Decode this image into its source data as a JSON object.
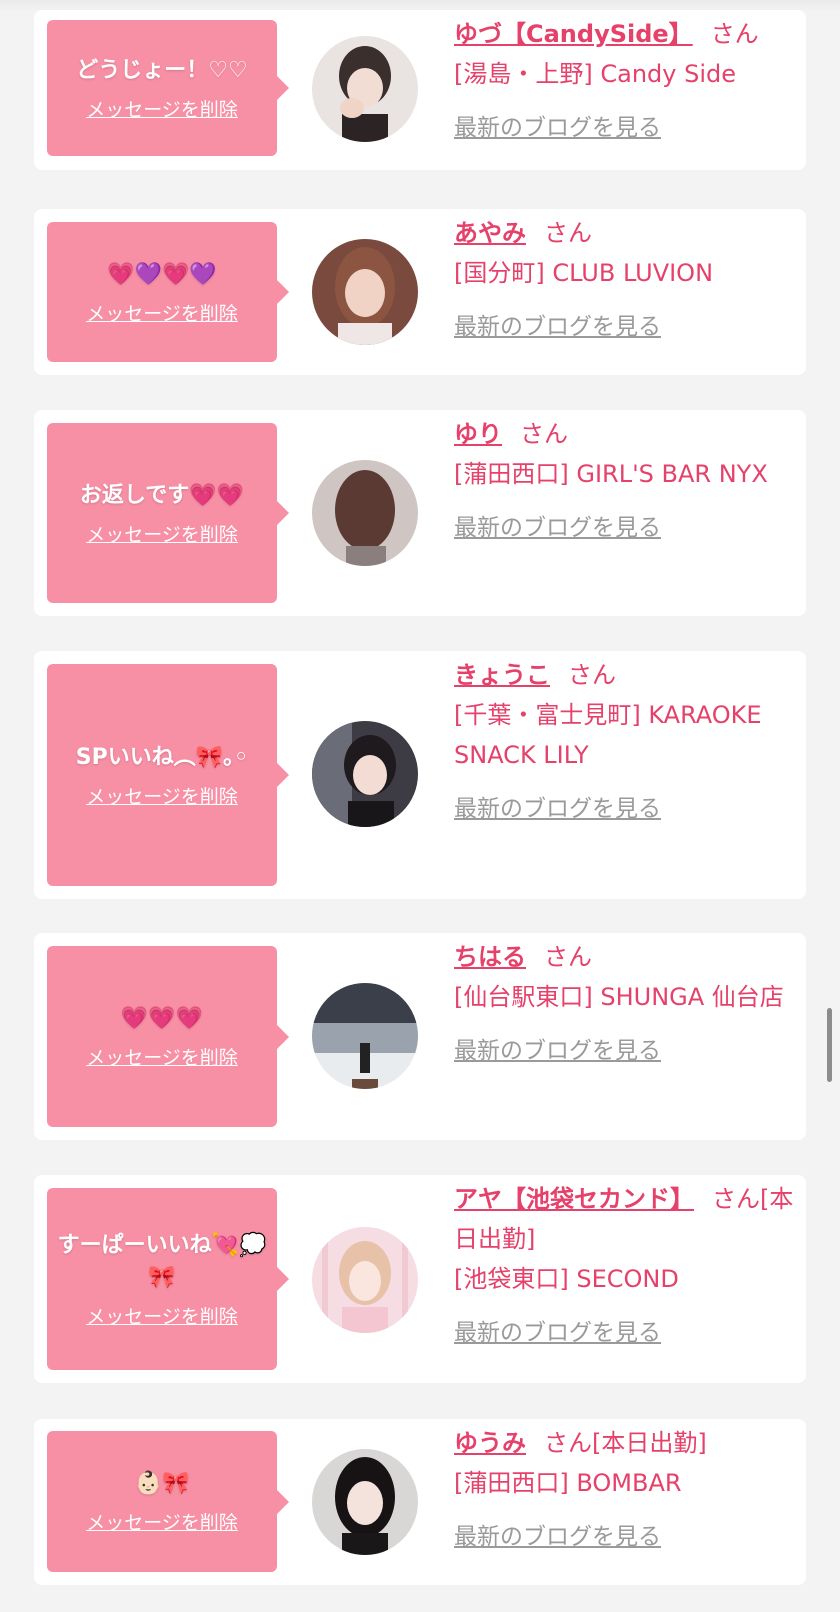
{
  "delete_label": "メッセージを削除",
  "blog_label": "最新のブログを見る",
  "san_label": "さん",
  "colors": {
    "bubble": "#f78fa5",
    "accent": "#e5416a",
    "link_gray": "#9a9a9a",
    "background": "#f3f3f3"
  },
  "items": [
    {
      "message": "どうじょー！♡♡",
      "name": "ゆづ【CandySide】",
      "suffix": "",
      "shop": "[湯島・上野] Candy Side"
    },
    {
      "message": "💗💜💗💜",
      "name": "あやみ",
      "suffix": "",
      "shop": "[国分町] CLUB LUVION"
    },
    {
      "message": "お返しです💗💗",
      "name": "ゆり",
      "suffix": "",
      "shop": "[蒲田西口] GIRL'S BAR NYX"
    },
    {
      "message": "SPいいね︵🎀｡◦",
      "name": "きょうこ",
      "suffix": "",
      "shop": "[千葉・富士見町] KARAOKE SNACK LILY"
    },
    {
      "message": "💗💗💗",
      "name": "ちはる",
      "suffix": "",
      "shop": "[仙台駅東口] SHUNGA 仙台店"
    },
    {
      "message": "すーぱーいいね💘💭🎀",
      "name": "アヤ【池袋セカンド】",
      "suffix": "[本日出勤]",
      "shop": "[池袋東口] SECOND"
    },
    {
      "message": "👶🏻🎀",
      "name": "ゆうみ",
      "suffix": "[本日出勤]",
      "shop": "[蒲田西口] BOMBAR"
    }
  ]
}
